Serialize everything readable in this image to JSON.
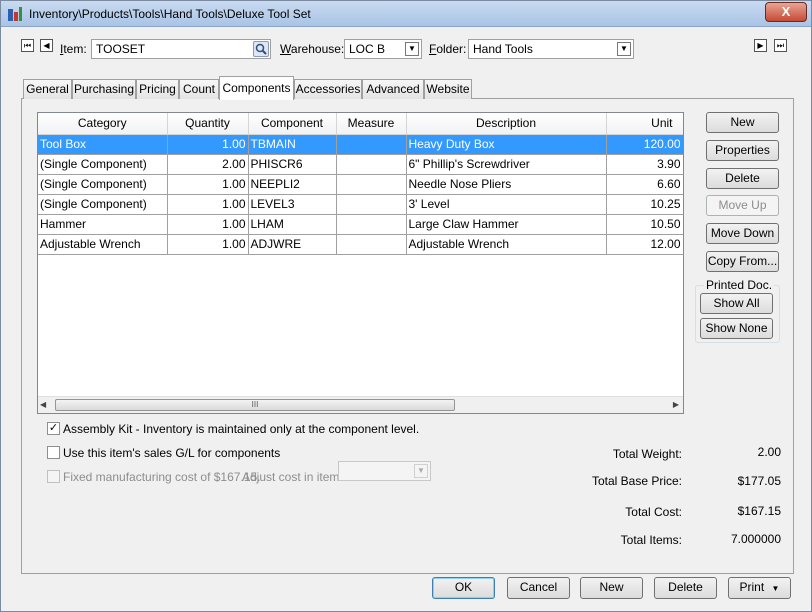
{
  "window": {
    "title": "Inventory\\Products\\Tools\\Hand Tools\\Deluxe Tool Set",
    "close_glyph": "X"
  },
  "header": {
    "first_glyph": "⏮",
    "prev_glyph": "◀",
    "next_glyph": "▶",
    "last_glyph": "⏭",
    "item_label_underlined": "I",
    "item_label_rest": "tem:",
    "item_value": "TOOSET",
    "warehouse_label_underlined": "W",
    "warehouse_label_rest": "arehouse:",
    "warehouse_value": "LOC B",
    "folder_label_underlined": "F",
    "folder_label_rest": "older:",
    "folder_value": "Hand Tools"
  },
  "tabs": [
    "General",
    "Purchasing",
    "Pricing",
    "Count",
    "Components",
    "Accessories",
    "Advanced",
    "Website"
  ],
  "grid": {
    "columns": [
      "Category",
      "Quantity",
      "Component",
      "Measure",
      "Description",
      "Unit"
    ],
    "rows": [
      [
        "Tool Box",
        "1.00",
        "TBMAIN",
        "",
        "Heavy Duty Box",
        "120.00"
      ],
      [
        "(Single Component)",
        "2.00",
        "PHISCR6",
        "",
        "6\" Phillip's Screwdriver",
        "3.90"
      ],
      [
        "(Single Component)",
        "1.00",
        "NEEPLI2",
        "",
        "Needle Nose Pliers",
        "6.60"
      ],
      [
        "(Single Component)",
        "1.00",
        "LEVEL3",
        "",
        "3' Level",
        "10.25"
      ],
      [
        "Hammer",
        "1.00",
        "LHAM",
        "",
        "Large Claw Hammer",
        "10.50"
      ],
      [
        "Adjustable Wrench",
        "1.00",
        "ADJWRE",
        "",
        "Adjustable Wrench",
        "12.00"
      ]
    ],
    "scroll_thumb": "III"
  },
  "side_buttons": {
    "new": "New",
    "properties": "Properties",
    "delete": "Delete",
    "move_up": "Move Up",
    "move_down": "Move Down",
    "copy_from": "Copy From...",
    "printed_doc": "Printed Doc.",
    "show_all": "Show All",
    "show_none": "Show None"
  },
  "options": {
    "assembly_kit": "Assembly Kit - Inventory is maintained only at the component level.",
    "assembly_kit_checked": true,
    "check_glyph": "✓",
    "use_sales_gl": "Use this item's sales G/L for components",
    "use_sales_gl_checked": false,
    "fixed_cost": "Fixed manufacturing cost of $167.15.",
    "adjust_cost": "Adjust cost in item:",
    "fixed_cost_checked": false
  },
  "totals": {
    "weight_label": "Total Weight:",
    "weight_value": "2.00",
    "base_price_label": "Total Base Price:",
    "base_price_value": "$177.05",
    "cost_label": "Total Cost:",
    "cost_value": "$167.15",
    "items_label": "Total Items:",
    "items_value": "7.000000"
  },
  "footer": {
    "ok": "OK",
    "cancel": "Cancel",
    "new": "New",
    "delete": "Delete",
    "print": "Print",
    "print_arrow": "▼"
  }
}
